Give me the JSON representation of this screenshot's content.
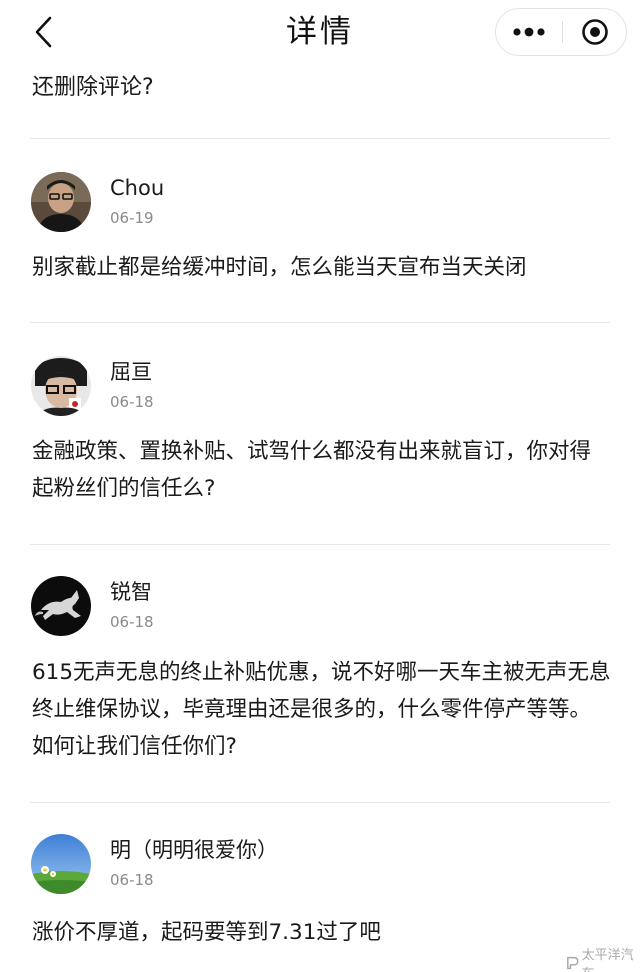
{
  "header": {
    "title": "详情",
    "back_icon": "chevron-left-icon",
    "more_icon": "more-dots-icon",
    "close_icon": "target-close-icon"
  },
  "partial_comment_text": "还删除评论?",
  "comments": [
    {
      "nickname": "Chou",
      "date": "06-19",
      "text": "别家截止都是给缓冲时间，怎么能当天宣布当天关闭"
    },
    {
      "nickname": "屈亘",
      "date": "06-18",
      "text": "金融政策、置换补贴、试驾什么都没有出来就盲订，你对得起粉丝们的信任么?"
    },
    {
      "nickname": "锐智",
      "date": "06-18",
      "text": "615无声无息的终止补贴优惠，说不好哪一天车主被无声无息终止维保协议，毕竟理由还是很多的，什么零件停产等等。如何让我们信任你们?"
    },
    {
      "nickname": "明（明明很爱你）",
      "date": "06-18",
      "text": "涨价不厚道，起码要等到7.31过了吧"
    }
  ],
  "watermark": {
    "text": "太平洋汽车"
  },
  "colors": {
    "text": "#1a1a1a",
    "date": "#8a8a8a",
    "divider": "#e8e8e8"
  }
}
